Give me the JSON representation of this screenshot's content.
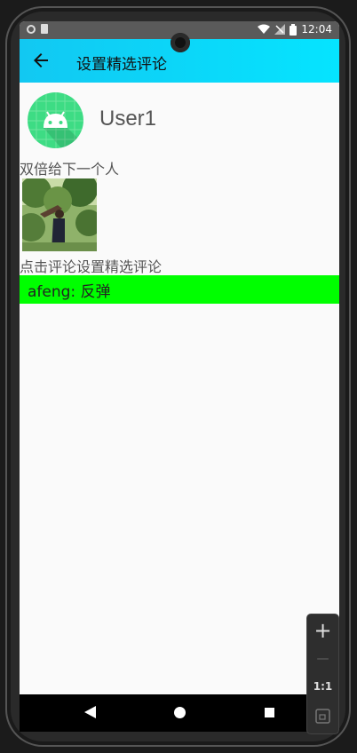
{
  "status_bar": {
    "time": "12:04"
  },
  "app_bar": {
    "title": "设置精选评论"
  },
  "user": {
    "name": "User1"
  },
  "post": {
    "text": "双倍给下一个人"
  },
  "hint": "点击评论设置精选评论",
  "comments": [
    {
      "text": "afeng: 反弹"
    }
  ],
  "zoom_control": {
    "plus": "+",
    "minus": "—",
    "ratio": "1:1"
  },
  "colors": {
    "app_bar_start": "#12c8f2",
    "app_bar_end": "#05e4ff",
    "highlight": "#00ff00",
    "avatar_bg": "#3ddc84"
  }
}
